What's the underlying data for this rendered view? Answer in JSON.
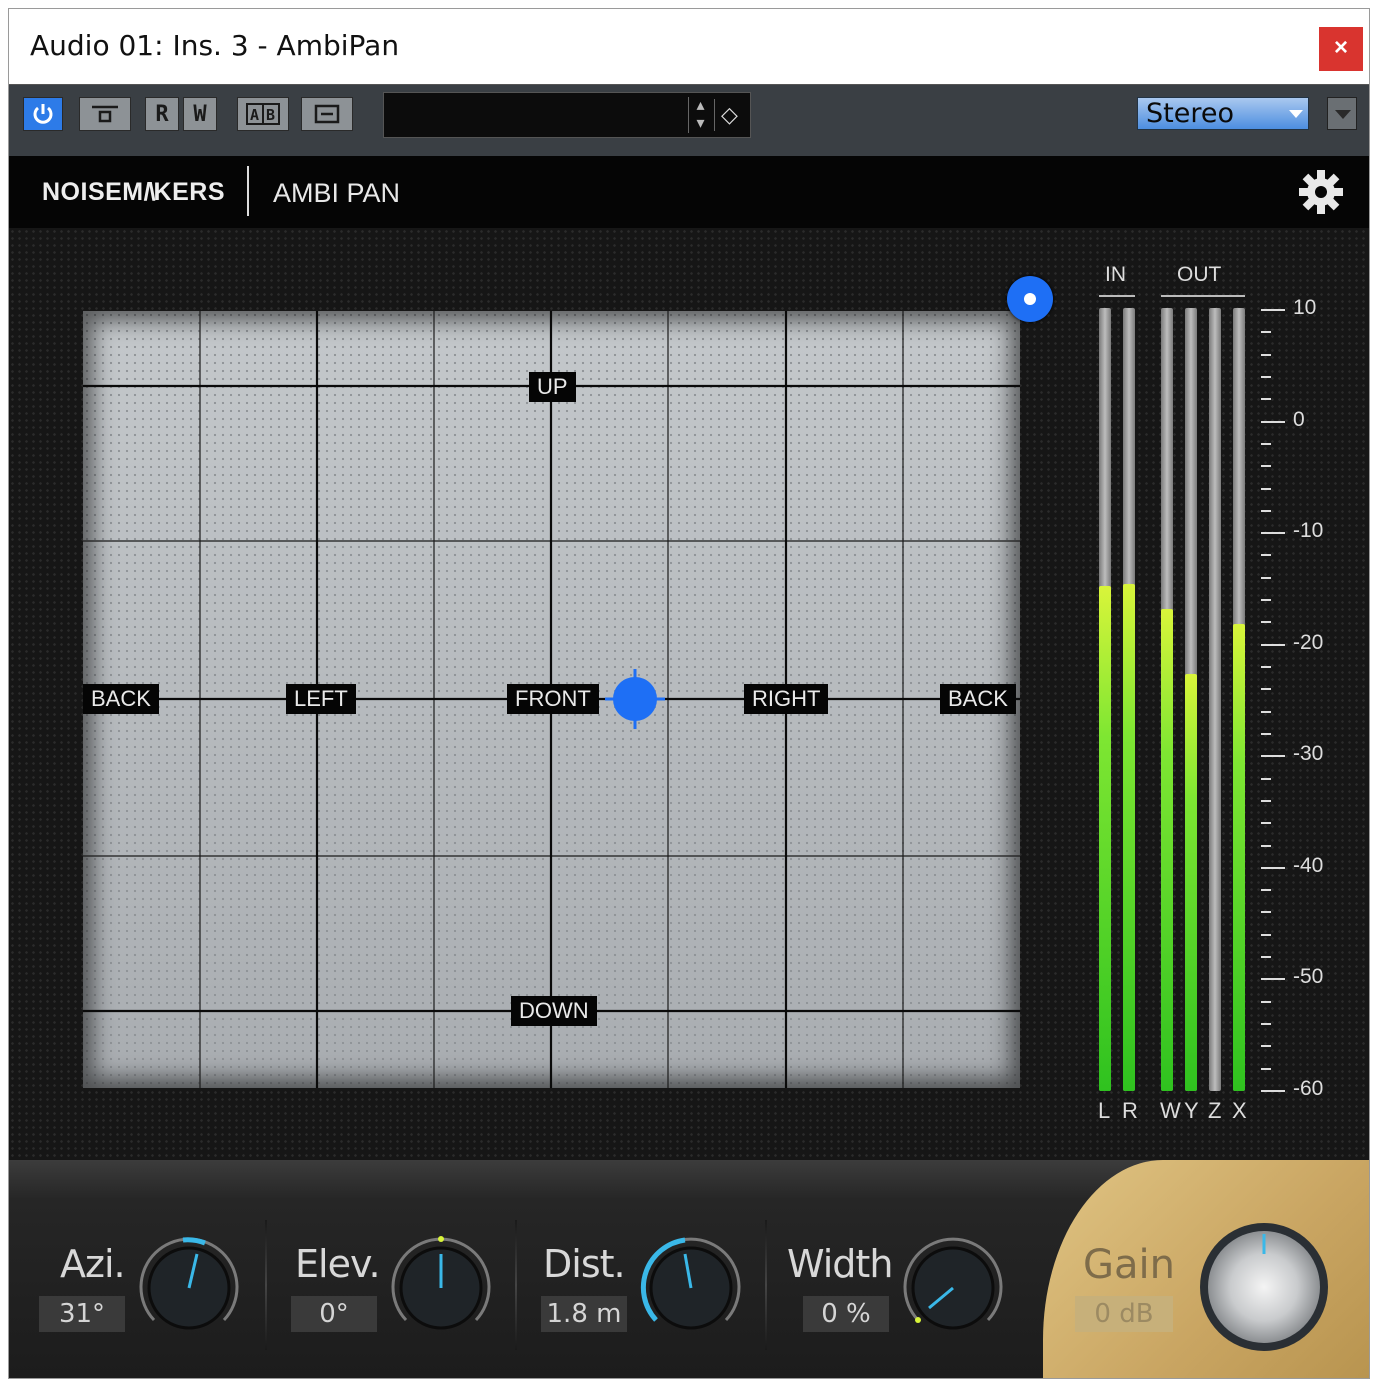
{
  "window": {
    "title": "Audio 01: Ins. 3 - AmbiPan",
    "close_label": "×"
  },
  "toolbar": {
    "buttons": [
      {
        "name": "power-button",
        "glyph": "⏻"
      },
      {
        "name": "bypass-button",
        "glyph": "▭"
      },
      {
        "name": "read-button",
        "glyph": "R"
      },
      {
        "name": "write-button",
        "glyph": "W"
      },
      {
        "name": "ab-compare-button",
        "glyph": "A|B"
      },
      {
        "name": "preset-menu-button",
        "glyph": "▤"
      }
    ],
    "preset_name": "",
    "output_config": "Stereo"
  },
  "plugin": {
    "brand": "NOISEM/\\KERS",
    "name": "AMBI PAN"
  },
  "pan_field": {
    "labels": {
      "up": "UP",
      "down": "DOWN",
      "back_left": "BACK",
      "left": "LEFT",
      "front": "FRONT",
      "right": "RIGHT",
      "back_right": "BACK"
    }
  },
  "meters": {
    "in_label": "IN",
    "out_label": "OUT",
    "channels": [
      {
        "label": "L",
        "level": 0.645
      },
      {
        "label": "R",
        "level": 0.648
      },
      {
        "label": "W",
        "level": 0.615
      },
      {
        "label": "Y",
        "level": 0.532
      },
      {
        "label": "Z",
        "level": 0.0
      },
      {
        "label": "X",
        "level": 0.596
      }
    ],
    "scale": [
      "10",
      "0",
      "-10",
      "-20",
      "-30",
      "-40",
      "-50",
      "-60"
    ]
  },
  "controls": {
    "azimuth": {
      "label": "Azi.",
      "value": "31°"
    },
    "elevation": {
      "label": "Elev.",
      "value": "0°"
    },
    "distance": {
      "label": "Dist.",
      "value": "1.8 m"
    },
    "width": {
      "label": "Width",
      "value": "0 %"
    },
    "gain": {
      "label": "Gain",
      "value": "0 dB"
    }
  },
  "colors": {
    "accent_blue": "#1e6ff5",
    "knob_indicator": "#3ab8e8",
    "meter_green": "#2fc21f",
    "meter_yellow": "#d9f53a",
    "gain_gold": "#c9a562"
  }
}
